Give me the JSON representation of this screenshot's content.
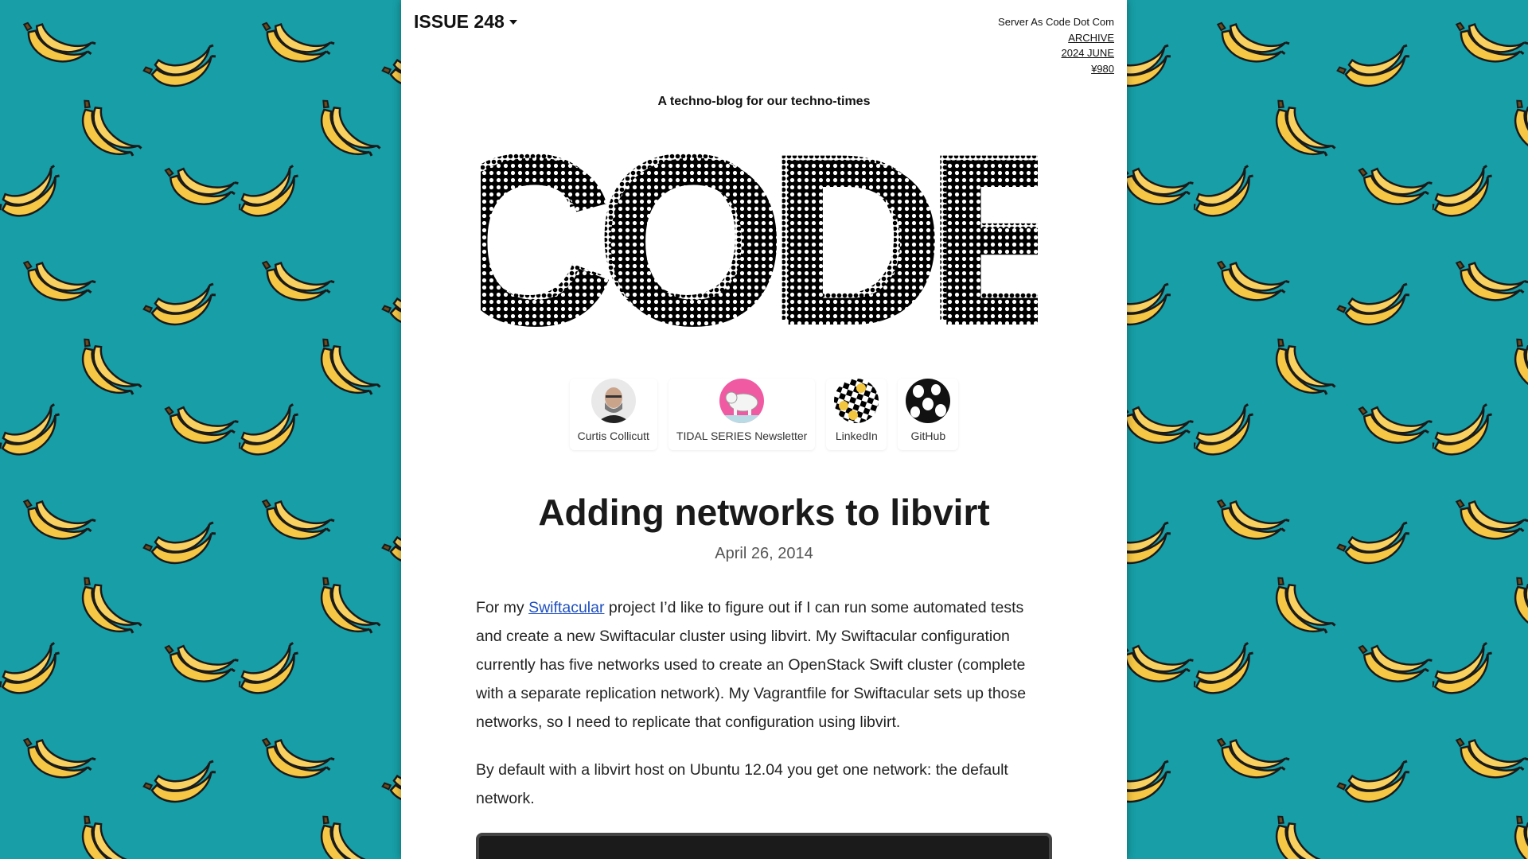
{
  "colors": {
    "background": "#179ea6",
    "banana": "#f6c744",
    "page": "#ffffff",
    "link": "#1f4fbf"
  },
  "header": {
    "issue_label": "ISSUE 248",
    "site_name": "Server As Code Dot Com",
    "archive_link": "ARCHIVE",
    "edition_link": "2024 JUNE",
    "price_link": "¥980"
  },
  "tagline": "A techno-blog for our techno-times",
  "logo_text": "CODE",
  "socials": [
    {
      "label": "Curtis Collicutt",
      "icon": "person-avatar-icon"
    },
    {
      "label": "TIDAL SERIES Newsletter",
      "icon": "polar-bear-avatar-icon"
    },
    {
      "label": "LinkedIn",
      "icon": "checkered-smiley-icon"
    },
    {
      "label": "GitHub",
      "icon": "ghost-pattern-icon"
    }
  ],
  "post": {
    "title": "Adding networks to libvirt",
    "date": "April 26, 2014",
    "p1_before": "For my ",
    "p1_link": "Swiftacular",
    "p1_after": " project I’d like to figure out if I can run some automated tests and create a new Swiftacular cluster using libvirt. My Swiftacular configuration currently has five networks used to create an OpenStack Swift cluster (complete with a separate replication network). My Vagrantfile for Swiftacular sets up those networks, so I need to replicate that configuration using libvirt.",
    "p2": "By default with a libvirt host on Ubuntu 12.04 you get one network: the default network.",
    "code_preview": ""
  }
}
